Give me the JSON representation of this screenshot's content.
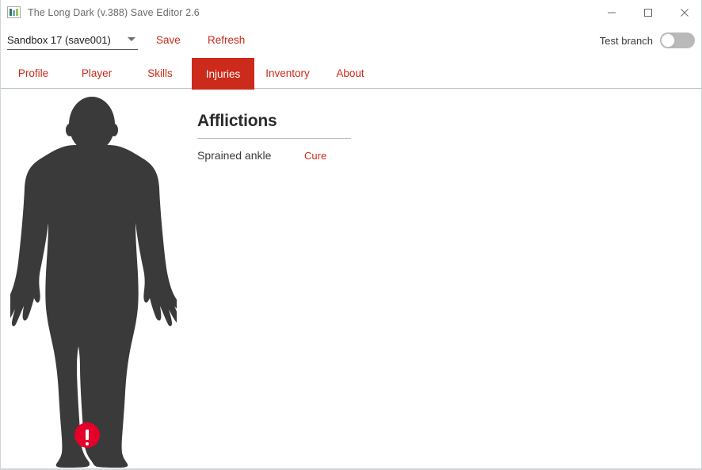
{
  "window": {
    "title": "The Long Dark (v.388) Save Editor 2.6",
    "app_icon": "picture-icon",
    "controls": {
      "minimize": "minimize-icon",
      "maximize": "maximize-icon",
      "close": "close-icon"
    }
  },
  "toolbar": {
    "save_select": {
      "value": "Sandbox 17 (save001)",
      "chevron": "chevron-down-icon"
    },
    "save_label": "Save",
    "refresh_label": "Refresh",
    "test_branch_label": "Test branch",
    "test_branch_state": "off"
  },
  "tabs": [
    {
      "label": "Profile",
      "active": false
    },
    {
      "label": "Player",
      "active": false
    },
    {
      "label": "Skills",
      "active": false
    },
    {
      "label": "Injuries",
      "active": true
    },
    {
      "label": "Inventory",
      "active": false
    },
    {
      "label": "About",
      "active": false
    }
  ],
  "main": {
    "body_figure": {
      "marker_icon": "exclamation-marker-icon",
      "marker_location": "left-ankle"
    },
    "afflictions": {
      "heading": "Afflictions",
      "rows": [
        {
          "name": "Sprained ankle",
          "action": "Cure"
        }
      ]
    }
  },
  "colors": {
    "accent_red": "#cc2a1a",
    "marker_red": "#e4002b",
    "silhouette": "#3a3a3a",
    "title_text": "#6b6b6b",
    "body_text": "#3a3a3a"
  }
}
